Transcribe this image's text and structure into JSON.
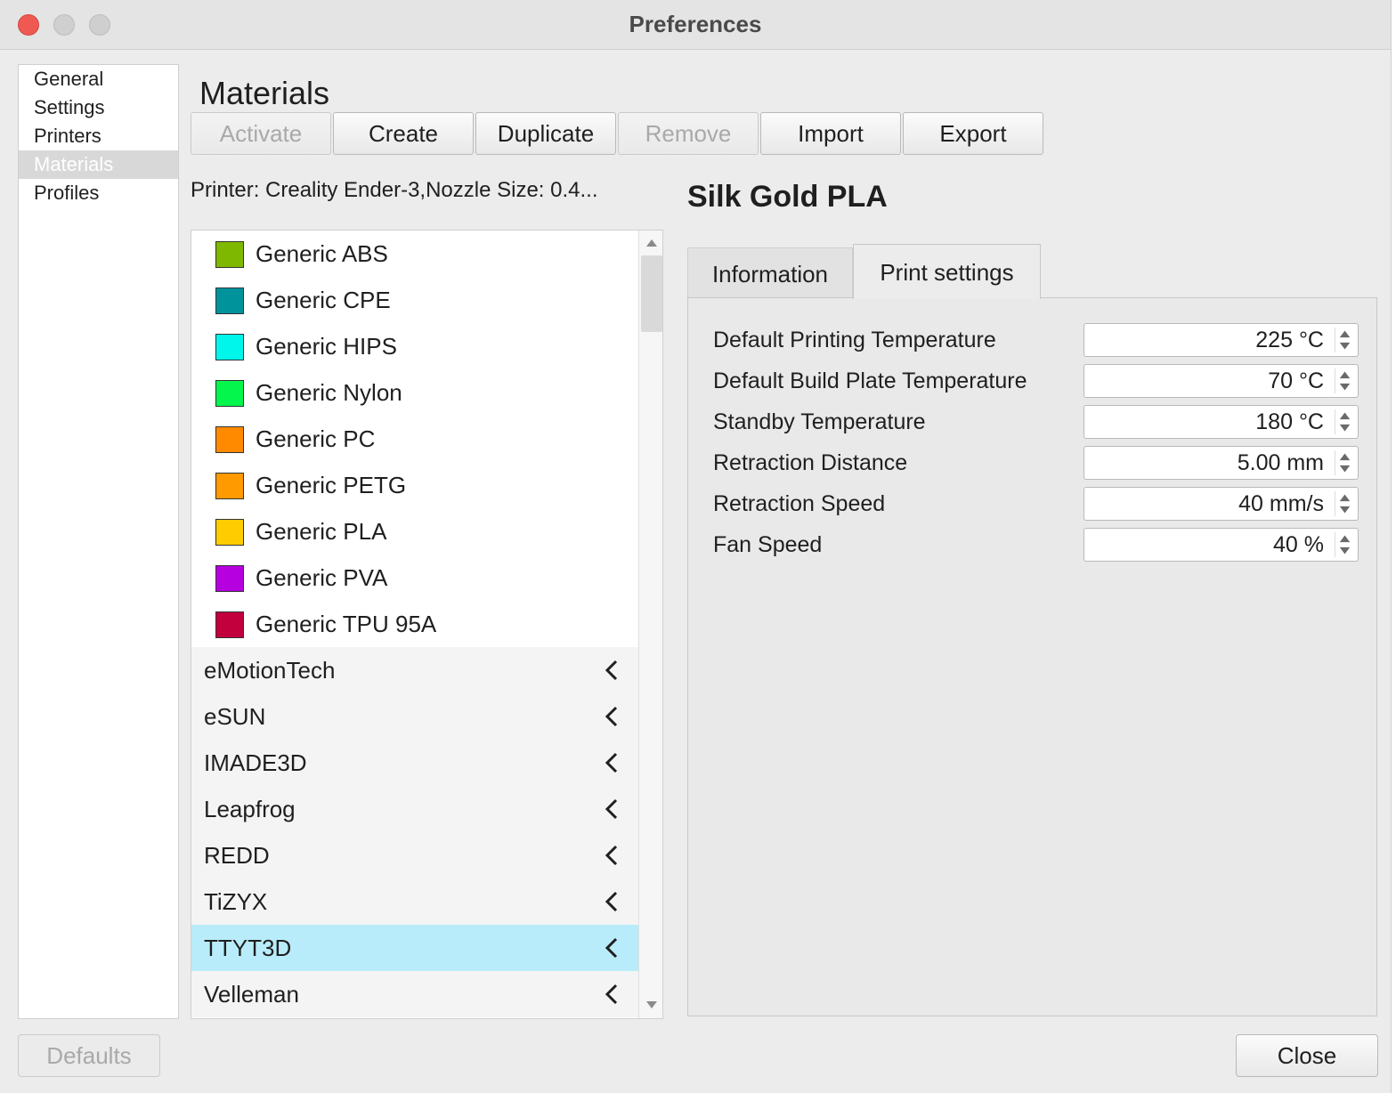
{
  "window": {
    "title": "Preferences"
  },
  "sidebar": {
    "items": [
      {
        "label": "General",
        "selected": false
      },
      {
        "label": "Settings",
        "selected": false
      },
      {
        "label": "Printers",
        "selected": false
      },
      {
        "label": "Materials",
        "selected": true
      },
      {
        "label": "Profiles",
        "selected": false
      }
    ]
  },
  "materials": {
    "section_title": "Materials",
    "toolbar": {
      "activate": "Activate",
      "create": "Create",
      "duplicate": "Duplicate",
      "remove": "Remove",
      "import": "Import",
      "export": "Export"
    },
    "printer_info": "Printer: Creality Ender-3,Nozzle Size: 0.4...",
    "generic_materials": [
      {
        "name": "Generic ABS",
        "color": "#7fb800"
      },
      {
        "name": "Generic CPE",
        "color": "#00939c"
      },
      {
        "name": "Generic HIPS",
        "color": "#00f6ea"
      },
      {
        "name": "Generic Nylon",
        "color": "#04f64c"
      },
      {
        "name": "Generic PC",
        "color": "#ff8a00"
      },
      {
        "name": "Generic PETG",
        "color": "#ff9a00"
      },
      {
        "name": "Generic PLA",
        "color": "#ffcc00"
      },
      {
        "name": "Generic PVA",
        "color": "#b600e0"
      },
      {
        "name": "Generic TPU 95A",
        "color": "#c1003d"
      }
    ],
    "brands": [
      {
        "name": "eMotionTech",
        "selected": false
      },
      {
        "name": "eSUN",
        "selected": false
      },
      {
        "name": "IMADE3D",
        "selected": false
      },
      {
        "name": "Leapfrog",
        "selected": false
      },
      {
        "name": "REDD",
        "selected": false
      },
      {
        "name": "TiZYX",
        "selected": false
      },
      {
        "name": "TTYT3D",
        "selected": true
      },
      {
        "name": "Velleman",
        "selected": false
      }
    ]
  },
  "detail": {
    "material_name": "Silk Gold PLA",
    "tabs": {
      "information": "Information",
      "print_settings": "Print settings"
    },
    "settings": [
      {
        "label": "Default Printing Temperature",
        "value": "225 °C"
      },
      {
        "label": "Default Build Plate Temperature",
        "value": "70 °C"
      },
      {
        "label": "Standby Temperature",
        "value": "180 °C"
      },
      {
        "label": "Retraction Distance",
        "value": "5.00 mm"
      },
      {
        "label": "Retraction Speed",
        "value": "40 mm/s"
      },
      {
        "label": "Fan Speed",
        "value": "40 %"
      }
    ]
  },
  "footer": {
    "defaults": "Defaults",
    "close": "Close"
  }
}
